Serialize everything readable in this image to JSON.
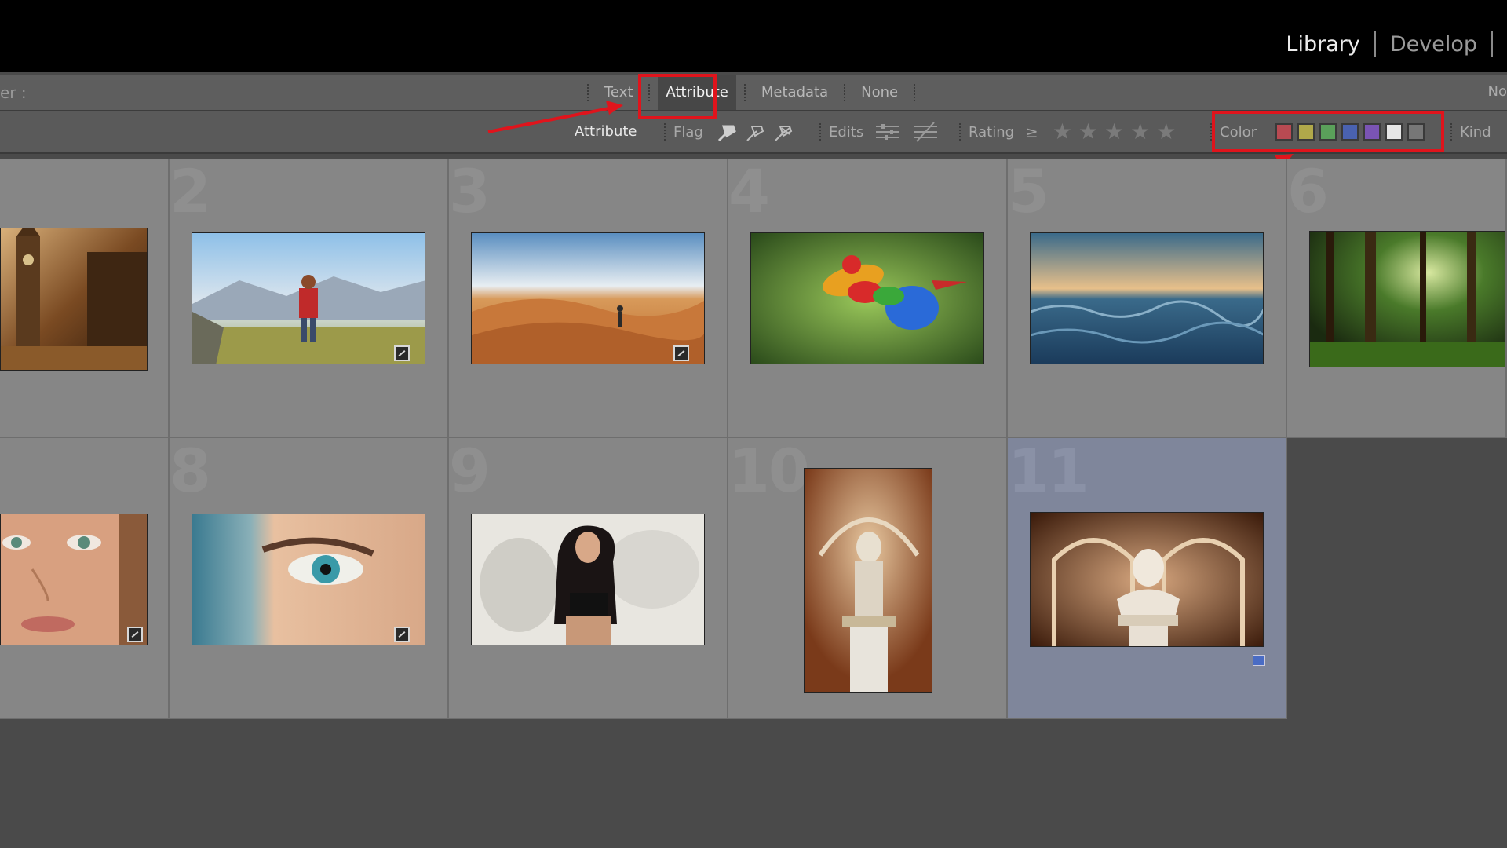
{
  "modules": {
    "library": "Library",
    "develop": "Develop"
  },
  "filter_bar": {
    "label": "er :",
    "tabs": [
      "Text",
      "Attribute",
      "Metadata",
      "None"
    ],
    "active_tab": "Attribute",
    "right_text": "No"
  },
  "attribute_bar": {
    "label": "Attribute",
    "flag_label": "Flag",
    "edits_label": "Edits",
    "rating_label": "Rating",
    "rating_op": "≥",
    "star_count": 5,
    "color_label": "Color",
    "kind_label": "Kind",
    "color_swatches": [
      "#b84a52",
      "#b0a84a",
      "#5aa05a",
      "#4a62b0",
      "#7a54b4",
      "#e6e6e6",
      "#777777"
    ]
  },
  "grid": {
    "cells": [
      {
        "number": "",
        "badge": false,
        "selected": false
      },
      {
        "number": "2",
        "badge": true,
        "selected": false
      },
      {
        "number": "3",
        "badge": true,
        "selected": false
      },
      {
        "number": "4",
        "badge": false,
        "selected": false
      },
      {
        "number": "5",
        "badge": false,
        "selected": false
      },
      {
        "number": "6",
        "badge": false,
        "selected": false
      },
      {
        "number": "",
        "badge": true,
        "selected": false
      },
      {
        "number": "8",
        "badge": true,
        "selected": false
      },
      {
        "number": "9",
        "badge": false,
        "selected": false
      },
      {
        "number": "10",
        "badge": false,
        "selected": false
      },
      {
        "number": "11",
        "badge": false,
        "selected": true
      }
    ]
  },
  "colors": {
    "accent_red": "#e0141c",
    "selection": "#7f869b"
  }
}
